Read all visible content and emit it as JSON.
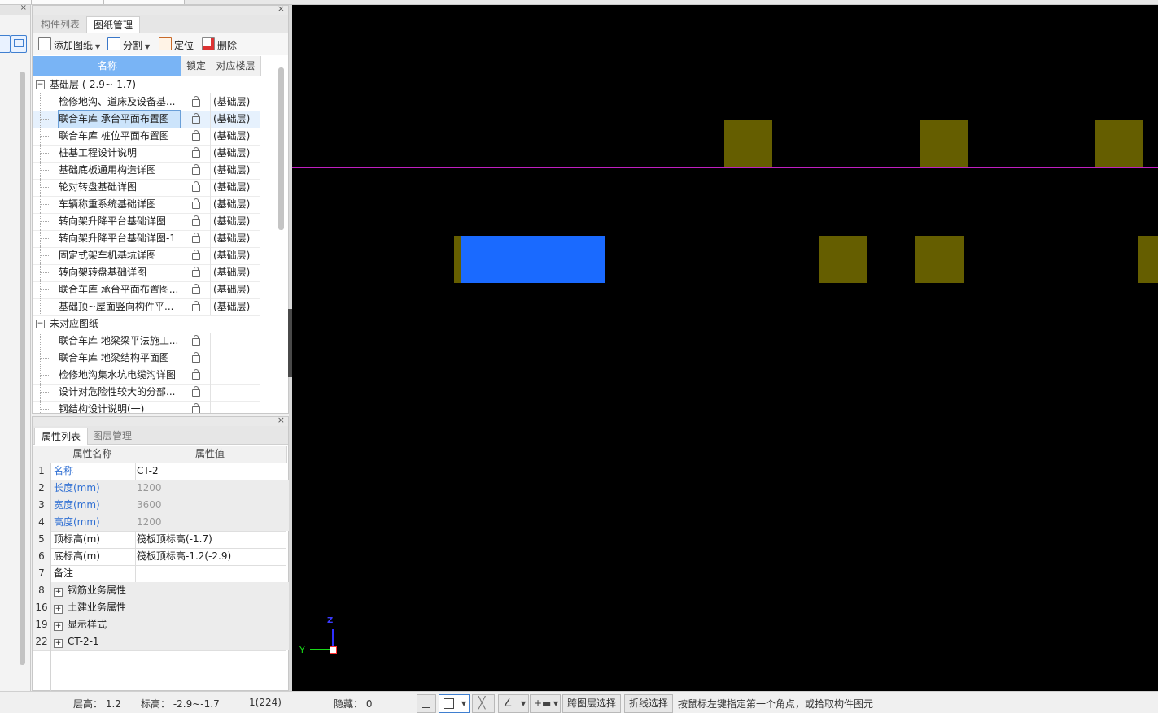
{
  "drawing_panel": {
    "tabs": [
      "构件列表",
      "图纸管理"
    ],
    "toolbar": {
      "add_drawing": "添加图纸",
      "split": "分割",
      "locate": "定位",
      "delete": "删除"
    },
    "columns": {
      "name": "名称",
      "lock": "锁定",
      "floor": "对应楼层"
    },
    "groups": [
      {
        "label": "基础层 (-2.9~-1.7)",
        "rows": [
          {
            "name": "检修地沟、道床及设备基...",
            "floor": "(基础层)"
          },
          {
            "name": "联合车库 承台平面布置图",
            "floor": "(基础层)"
          },
          {
            "name": "联合车库 桩位平面布置图",
            "floor": "(基础层)"
          },
          {
            "name": "桩基工程设计说明",
            "floor": "(基础层)"
          },
          {
            "name": "基础底板通用构造详图",
            "floor": "(基础层)"
          },
          {
            "name": "轮对转盘基础详图",
            "floor": "(基础层)"
          },
          {
            "name": "车辆称重系统基础详图",
            "floor": "(基础层)"
          },
          {
            "name": "转向架升降平台基础详图",
            "floor": "(基础层)"
          },
          {
            "name": "转向架升降平台基础详图-1",
            "floor": "(基础层)"
          },
          {
            "name": "固定式架车机基坑详图",
            "floor": "(基础层)"
          },
          {
            "name": "转向架转盘基础详图",
            "floor": "(基础层)"
          },
          {
            "name": "联合车库 承台平面布置图...",
            "floor": "(基础层)"
          },
          {
            "name": "基础顶~屋面竖向构件平...",
            "floor": "(基础层)"
          }
        ]
      },
      {
        "label": "未对应图纸",
        "rows": [
          {
            "name": "联合车库 地梁梁平法施工...",
            "floor": ""
          },
          {
            "name": "联合车库 地梁结构平面图",
            "floor": ""
          },
          {
            "name": "检修地沟集水坑电缆沟详图",
            "floor": ""
          },
          {
            "name": "设计对危险性较大的分部...",
            "floor": ""
          },
          {
            "name": "钢结构设计说明(一)",
            "floor": ""
          }
        ]
      }
    ]
  },
  "property_panel": {
    "tabs": [
      "属性列表",
      "图层管理"
    ],
    "columns": {
      "name": "属性名称",
      "value": "属性值"
    },
    "rows": [
      {
        "no": "1",
        "name": "名称",
        "value": "CT-2"
      },
      {
        "no": "2",
        "name": "长度(mm)",
        "value": "1200"
      },
      {
        "no": "3",
        "name": "宽度(mm)",
        "value": "3600"
      },
      {
        "no": "4",
        "name": "高度(mm)",
        "value": "1200"
      },
      {
        "no": "5",
        "name": "顶标高(m)",
        "value": "筏板顶标高(-1.7)"
      },
      {
        "no": "6",
        "name": "底标高(m)",
        "value": "筏板顶标高-1.2(-2.9)"
      },
      {
        "no": "7",
        "name": "备注",
        "value": ""
      },
      {
        "no": "8",
        "name": "钢筋业务属性",
        "value": ""
      },
      {
        "no": "16",
        "name": "土建业务属性",
        "value": ""
      },
      {
        "no": "19",
        "name": "显示样式",
        "value": ""
      },
      {
        "no": "22",
        "name": "CT-2-1",
        "value": ""
      }
    ]
  },
  "canvas": {
    "background": "#000000",
    "element_color": "#655e00",
    "selected_color": "#1a6aff",
    "axis_y": "Y",
    "axis_z": "Z"
  },
  "status_bar": {
    "floor_height": "层高：  1.2",
    "elevation": "标高：  -2.9~-1.7",
    "count": "1(224)",
    "hidden": "隐藏：  0",
    "cross_layer_select": "跨图层选择",
    "polyline_select": "折线选择",
    "hint": "按鼠标左键指定第一个角点，或拾取构件图元"
  }
}
